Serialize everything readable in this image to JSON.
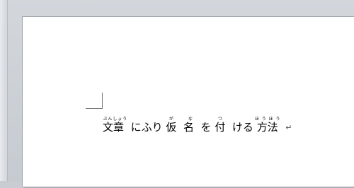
{
  "document": {
    "segments": [
      {
        "base": "文章",
        "ruby": "ぶんしょう"
      },
      {
        "base": "にふり",
        "ruby": ""
      },
      {
        "base": "仮",
        "ruby": "が"
      },
      {
        "base": "名",
        "ruby": "な"
      },
      {
        "base": "を",
        "ruby": ""
      },
      {
        "base": "付",
        "ruby": "つ"
      },
      {
        "base": "ける",
        "ruby": ""
      },
      {
        "base": "方法",
        "ruby": "ほうほう"
      }
    ],
    "paragraph_mark": "↵"
  }
}
